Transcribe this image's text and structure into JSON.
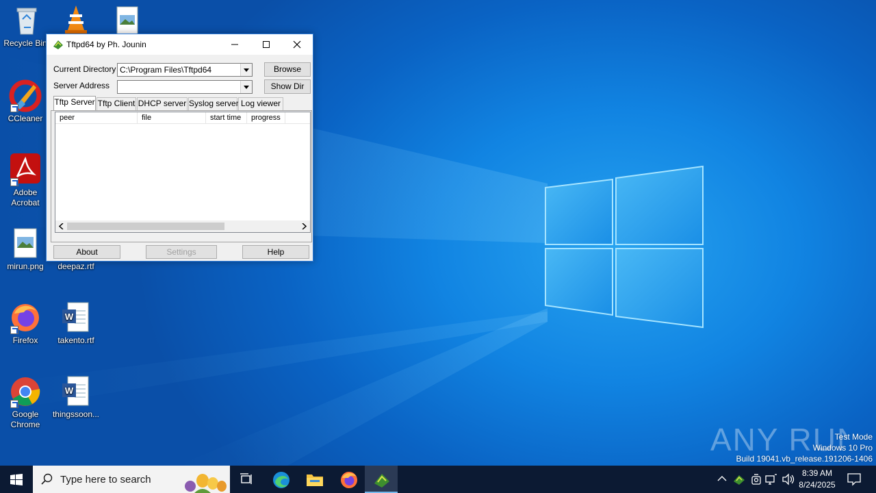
{
  "desktop": {
    "icons": [
      {
        "label": "Recycle Bin"
      },
      {
        "label": ""
      },
      {
        "label": ""
      },
      {
        "label": "CCleaner"
      },
      {
        "label": "Adobe Acrobat"
      },
      {
        "label": "mirun.png"
      },
      {
        "label": "deepaz.rtf"
      },
      {
        "label": "Firefox"
      },
      {
        "label": "takento.rtf"
      },
      {
        "label": "Google Chrome"
      },
      {
        "label": "thingssoon..."
      }
    ]
  },
  "window": {
    "title": "Tftpd64 by Ph. Jounin",
    "current_directory_label": "Current Directory",
    "current_directory_value": "C:\\Program Files\\Tftpd64",
    "server_address_label": "Server Address",
    "server_address_value": "",
    "browse_label": "Browse",
    "show_dir_label": "Show Dir",
    "tabs": [
      {
        "label": "Tftp Server",
        "active": true
      },
      {
        "label": "Tftp Client",
        "active": false
      },
      {
        "label": "DHCP server",
        "active": false
      },
      {
        "label": "Syslog server",
        "active": false
      },
      {
        "label": "Log viewer",
        "active": false
      }
    ],
    "columns": [
      "peer",
      "file",
      "start time",
      "progress"
    ],
    "about_label": "About",
    "settings_label": "Settings",
    "help_label": "Help"
  },
  "taskbar": {
    "search_placeholder": "Type here to search",
    "time": "8:39 AM",
    "date": "8/24/2025"
  },
  "watermark": {
    "brand": "ANY RUN",
    "mode": "Test Mode",
    "os": "Windows 10 Pro",
    "build": "Build 19041.vb_release.191206-1406"
  },
  "colors": {
    "accent": "#2b79d6",
    "taskbar": "#0c1a33",
    "desktop": "#1184e2"
  }
}
